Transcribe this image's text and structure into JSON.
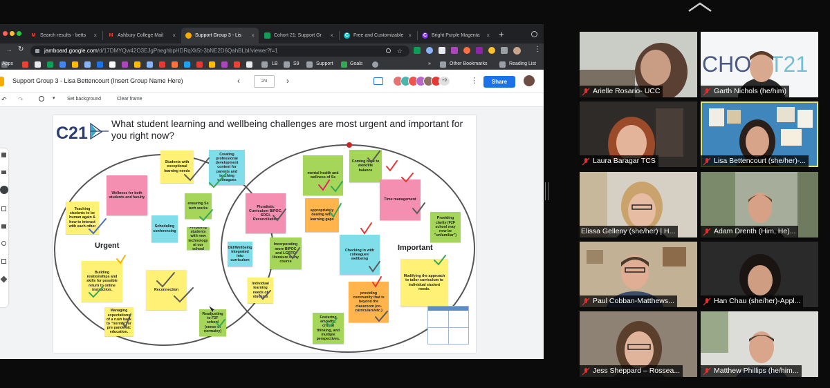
{
  "browser": {
    "tabs": [
      {
        "label": "Search results - betts",
        "icon": "gmail-icon",
        "active": false
      },
      {
        "label": "Ashbury College Mail",
        "icon": "gmail-icon",
        "active": false
      },
      {
        "label": "Support Group 3 - Lis",
        "icon": "jamboard-icon",
        "active": true
      },
      {
        "label": "Cohort 21: Support Gr",
        "icon": "sheets-icon",
        "active": false
      },
      {
        "label": "Free and Customizable",
        "icon": "canva-icon",
        "active": false
      },
      {
        "label": "Bright Purple Magenta",
        "icon": "canva-icon",
        "active": false
      }
    ],
    "url_host": "jamboard.google.com",
    "url_path": "/d/17DMYQw42O3EJgPneghbpHDRqXk5t-3bNE2D6QahBLbI/viewer?f=1",
    "bookmarks": [
      "Apps",
      "LB",
      "S9",
      "Support",
      "Goals",
      "Other Bookmarks",
      "Reading List"
    ]
  },
  "jamboard": {
    "title": "Support Group 3 - Lisa Bettencourt (Insert Group Name Here)",
    "frame_counter": "2/4",
    "collaborator_overflow": "+9",
    "share_label": "Share",
    "set_background_label": "Set background",
    "clear_frame_label": "Clear frame",
    "logo_text": "C21",
    "question": "What student learning and wellbeing challenges are most urgent and important for you right now?",
    "urgent_label": "Urgent",
    "important_label": "Important",
    "notes": [
      {
        "text": "Wellness for both students and faculty"
      },
      {
        "text": "Students with exceptional learning needs"
      },
      {
        "text": "Creating professional development content for parents and teaching colleagues"
      },
      {
        "text": "Teaching students to be human again & how to interact with each other"
      },
      {
        "text": "ensuring Ss tech works"
      },
      {
        "text": "Scheduling conferencing"
      },
      {
        "text": "Preparing students with new technology at our school"
      },
      {
        "text": "Building relationships and skills for possible return to online instruction."
      },
      {
        "text": "Reconnection"
      },
      {
        "text": "Managing expectations of a rush back to \"normal\" or pre pandemic education."
      },
      {
        "text": "Readjusting to F2F school (sense of normalcy)"
      },
      {
        "text": "Pluralistic Curriculum BIPOC, SOGI, Reconciliation"
      },
      {
        "text": "DEI/Wellbeing integrated into curriculum"
      },
      {
        "text": "Incorporating more BIPOC and LGBTQ literature in my course"
      },
      {
        "text": "Individual learning needs of students"
      },
      {
        "text": "mental health and wellness of Ss"
      },
      {
        "text": "Coming back to work/life balance"
      },
      {
        "text": "appropriately dealing with learning gaps"
      },
      {
        "text": "Time management"
      },
      {
        "text": "Providing clarity (F2F school may now be \"unfamiliar\")"
      },
      {
        "text": "Checking in with colleagues' wellbeing"
      },
      {
        "text": "Modifying the approach to tailor curriculum to individual student needs."
      },
      {
        "text": "providing community that is beyond the classroom (co-curriculars/etc.)"
      },
      {
        "text": "Fostering empathy, critical thinking, and multiple perspectives."
      }
    ]
  },
  "participants": [
    {
      "name": "Arielle Rosario- UCC",
      "muted": true,
      "active_speaker": false
    },
    {
      "name": "Garth Nichols (he/him)",
      "muted": true,
      "active_speaker": false
    },
    {
      "name": "Laura Baragar TCS",
      "muted": true,
      "active_speaker": false
    },
    {
      "name": "Lisa Bettencourt (she/her)-...",
      "muted": true,
      "active_speaker": true
    },
    {
      "name": "Elissa Gelleny (she/her) | H...",
      "muted": false,
      "active_speaker": false
    },
    {
      "name": "Adam Drenth (Him, He)...",
      "muted": true,
      "active_speaker": false
    },
    {
      "name": "Paul Cobban-Matthews...",
      "muted": true,
      "active_speaker": false
    },
    {
      "name": "Han Chau (she/her)-Appl...",
      "muted": true,
      "active_speaker": false
    },
    {
      "name": "Jess Sheppard – Rossea...",
      "muted": true,
      "active_speaker": false
    },
    {
      "name": "Matthew Phillips (he/him...",
      "muted": true,
      "active_speaker": false
    }
  ],
  "colors": {
    "note_yellow": "#fff176",
    "note_pink": "#f48fb1",
    "note_blue": "#80deea",
    "note_green": "#a5d65a",
    "note_orange": "#ffb54c",
    "share_blue": "#1a73e8",
    "active_speaker_border": "#e3e86a",
    "muted_red": "#e02f2f"
  }
}
